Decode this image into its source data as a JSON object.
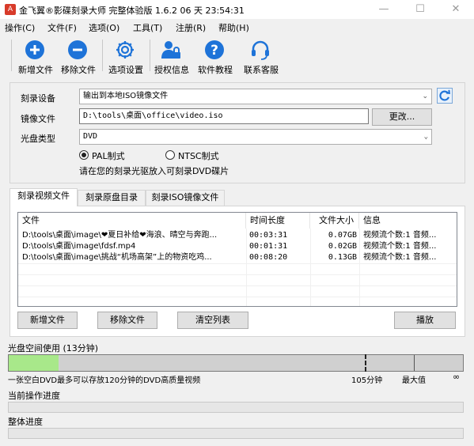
{
  "window": {
    "title": "金飞翼®影碟刻录大师 完整体验版 1.6.2 06 天 23:54:31",
    "min_glyph": "—",
    "max_glyph": "☐",
    "close_glyph": "✕",
    "icon_glyph": "A"
  },
  "menu": [
    "操作(C)",
    "文件(F)",
    "选项(O)",
    "工具(T)",
    "注册(R)",
    "帮助(H)"
  ],
  "toolbar": {
    "add_file": "新增文件",
    "remove_file": "移除文件",
    "options": "选项设置",
    "license": "授权信息",
    "tutorial": "软件教程",
    "support": "联系客服"
  },
  "settings": {
    "burner_label": "刻录设备",
    "burner_value": "输出到本地ISO镜像文件",
    "image_label": "镜像文件",
    "image_value": "D:\\tools\\桌面\\office\\video.iso",
    "change_button": "更改...",
    "disc_type_label": "光盘类型",
    "disc_type_value": "DVD",
    "pal_label": "PAL制式",
    "ntsc_label": "NTSC制式",
    "pal_selected": true,
    "hint": "请在您的刻录光驱放入可刻录DVD碟片"
  },
  "tabs": [
    "刻录视频文件",
    "刻录原盘目录",
    "刻录ISO镜像文件"
  ],
  "active_tab": 0,
  "file_list": {
    "columns": [
      "文件",
      "时间长度",
      "文件大小",
      "信息"
    ],
    "rows": [
      {
        "file": "D:\\tools\\桌面\\image\\❤夏日补给❤海浪、晴空与奔跑...",
        "duration": "00:03:31",
        "size": "0.07GB",
        "info": "视频流个数:1 音频..."
      },
      {
        "file": "D:\\tools\\桌面\\image\\fdsf.mp4",
        "duration": "00:01:31",
        "size": "0.02GB",
        "info": "视频流个数:1 音频..."
      },
      {
        "file": "D:\\tools\\桌面\\image\\挑战“机场高架”上的物资吃鸡...",
        "duration": "00:08:20",
        "size": "0.13GB",
        "info": "视频流个数:1 音频..."
      }
    ]
  },
  "list_buttons": {
    "add": "新增文件",
    "remove": "移除文件",
    "clear": "清空列表",
    "play": "播放"
  },
  "disc_usage": {
    "label": "光盘空间使用 (13分钟)",
    "used_fraction": 0.11,
    "caption": "一张空白DVD最多可以存放120分钟的DVD高质量视频",
    "mark_105": "105分钟",
    "mark_max": "最大值",
    "mark_inf": "∞"
  },
  "progress": {
    "current_label": "当前操作进度",
    "current_value": 0,
    "overall_label": "整体进度",
    "overall_value": 0
  },
  "colors": {
    "accent_blue": "#1e73d8",
    "disc_fill": "#a8e88a"
  }
}
